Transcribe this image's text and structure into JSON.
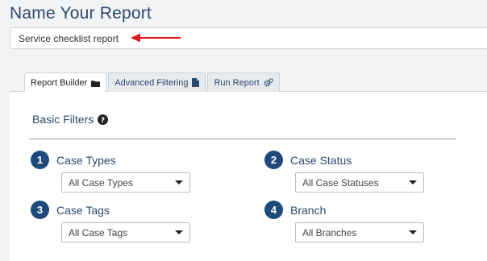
{
  "page": {
    "title": "Name Your Report"
  },
  "report_name": {
    "value": "Service checklist report"
  },
  "tabs": [
    {
      "label": "Report Builder",
      "icon": "folder-icon"
    },
    {
      "label": "Advanced Filtering",
      "icon": "document-icon"
    },
    {
      "label": "Run Report",
      "icon": "gears-icon"
    }
  ],
  "basic_filters": {
    "heading": "Basic Filters"
  },
  "filters": [
    {
      "number": "1",
      "label": "Case Types",
      "selected": "All Case Types"
    },
    {
      "number": "2",
      "label": "Case Status",
      "selected": "All Case Statuses"
    },
    {
      "number": "3",
      "label": "Case Tags",
      "selected": "All Case Tags"
    },
    {
      "number": "4",
      "label": "Branch",
      "selected": "All Branches"
    }
  ],
  "colors": {
    "accent": "#1d4a7a",
    "heading": "#2c4a6e",
    "annotation_arrow": "#e01b1b"
  }
}
